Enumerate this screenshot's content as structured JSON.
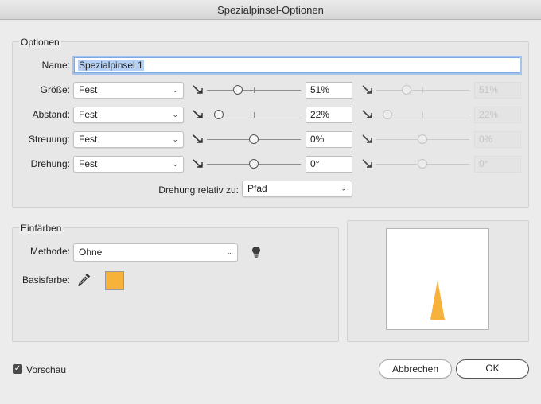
{
  "window": {
    "title": "Spezialpinsel-Optionen"
  },
  "options": {
    "legend": "Optionen",
    "name_label": "Name:",
    "name_value": "Spezialpinsel 1",
    "rows": [
      {
        "label": "Größe:",
        "mode": "Fest",
        "value": "51%",
        "disabled_value": "51%",
        "level": 0.33,
        "disabled_level": 0.33
      },
      {
        "label": "Abstand:",
        "mode": "Fest",
        "value": "22%",
        "disabled_value": "22%",
        "level": 0.13,
        "disabled_level": 0.13
      },
      {
        "label": "Streuung:",
        "mode": "Fest",
        "value": "0%",
        "disabled_value": "0%",
        "level": 0.5,
        "disabled_level": 0.5
      },
      {
        "label": "Drehung:",
        "mode": "Fest",
        "value": "0°",
        "disabled_value": "0°",
        "level": 0.5,
        "disabled_level": 0.5
      }
    ],
    "relative_label": "Drehung relativ zu:",
    "relative_value": "Pfad"
  },
  "colorize": {
    "legend": "Einfärben",
    "method_label": "Methode:",
    "method_value": "Ohne",
    "base_color_label": "Basisfarbe:",
    "base_color": "#f7b23b",
    "tip_icon": "lightbulb-icon",
    "eyedropper_icon": "eyedropper-icon"
  },
  "preview": {
    "shape_color": "#f7b23b"
  },
  "footer": {
    "preview_label": "Vorschau",
    "preview_checked": true,
    "cancel_label": "Abbrechen",
    "ok_label": "OK"
  }
}
